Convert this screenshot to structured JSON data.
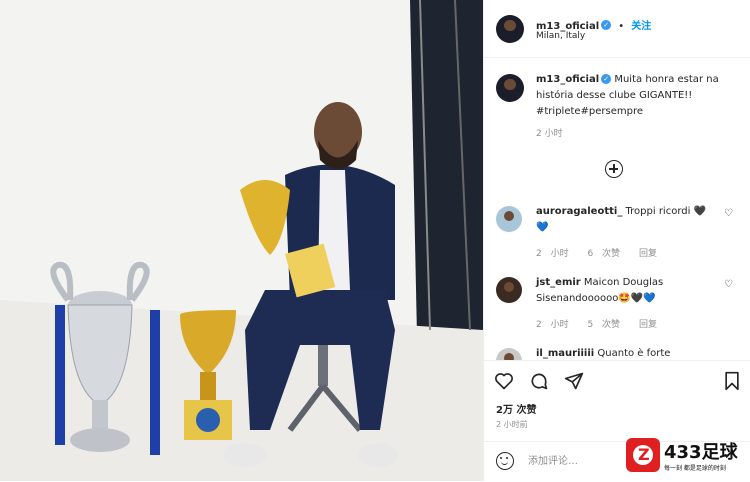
{
  "post": {
    "username": "m13_oficial",
    "follow_label": "关注",
    "location": "Milan, Italy",
    "caption": "Muita honra estar na história desse clube GIGANTE!! #triplete#persempre",
    "caption_time": "2 小时",
    "likes": "2万 次赞",
    "post_time": "2 小时前",
    "comment_placeholder": "添加评论…"
  },
  "comments": [
    {
      "user": "auroragaleotti_",
      "text": "Troppi ricordi 🖤💙",
      "time": "2 小时",
      "likes": "6 次赞",
      "reply": "回复"
    },
    {
      "user": "jst_emir",
      "text": "Maicon Douglas Sisenandoooooo🤩🖤💙",
      "time": "2 小时",
      "likes": "5 次赞",
      "reply": "回复"
    },
    {
      "user": "il_mauriiiii",
      "text": "Quanto è forte"
    }
  ],
  "icons": {
    "verified": "verified-badge-icon",
    "heart": "heart-icon",
    "comment": "comment-icon",
    "share": "share-icon",
    "bookmark": "bookmark-icon",
    "load_more": "plus-circle-icon",
    "emoji": "emoji-icon"
  },
  "colors": {
    "accent": "#0095f6",
    "verified": "#3897f0",
    "text": "#262626",
    "muted": "#8e8e8e",
    "watermark": "#e02020"
  },
  "watermark": {
    "brand": "433足球",
    "slogan": "每一刻 都是足球的时刻"
  }
}
